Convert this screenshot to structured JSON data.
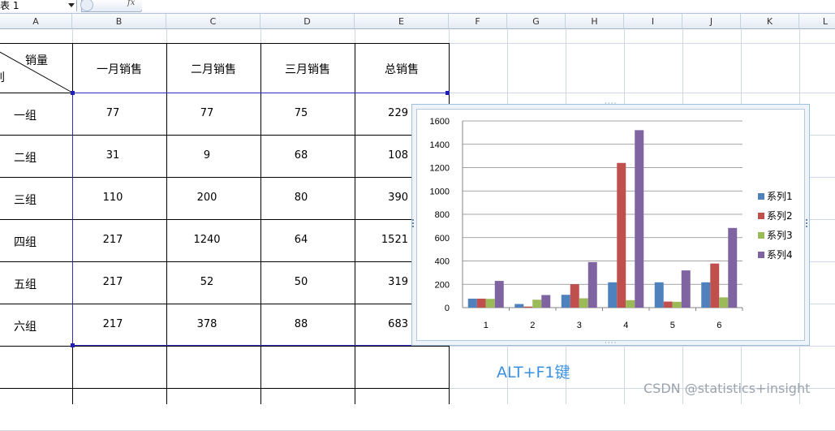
{
  "name_box": {
    "value": "表 1"
  },
  "formula_bar": {
    "fx_label": "fx"
  },
  "columns": [
    "A",
    "B",
    "C",
    "D",
    "E",
    "F",
    "G",
    "H",
    "I",
    "J",
    "K",
    "L"
  ],
  "table": {
    "header_corner_top": "销量",
    "header_corner_bottom": "组别",
    "headers": [
      "一月销售",
      "二月销售",
      "三月销售",
      "总销售"
    ],
    "rows": [
      {
        "group": "一组",
        "jan": "77",
        "feb": "77",
        "mar": "75",
        "total": "229"
      },
      {
        "group": "二组",
        "jan": "31",
        "feb": "9",
        "mar": "68",
        "total": "108"
      },
      {
        "group": "三组",
        "jan": "110",
        "feb": "200",
        "mar": "80",
        "total": "390"
      },
      {
        "group": "四组",
        "jan": "217",
        "feb": "1240",
        "mar": "64",
        "total": "1521"
      },
      {
        "group": "五组",
        "jan": "217",
        "feb": "52",
        "mar": "50",
        "total": "319"
      },
      {
        "group": "六组",
        "jan": "217",
        "feb": "378",
        "mar": "88",
        "total": "683"
      }
    ]
  },
  "chart_data": {
    "type": "bar",
    "categories": [
      "1",
      "2",
      "3",
      "4",
      "5",
      "6"
    ],
    "series": [
      {
        "name": "系列1",
        "color": "#4f81bd",
        "values": [
          77,
          31,
          110,
          217,
          217,
          217
        ]
      },
      {
        "name": "系列2",
        "color": "#c0504d",
        "values": [
          77,
          9,
          200,
          1240,
          52,
          378
        ]
      },
      {
        "name": "系列3",
        "color": "#9bbb59",
        "values": [
          75,
          68,
          80,
          64,
          50,
          88
        ]
      },
      {
        "name": "系列4",
        "color": "#8064a2",
        "values": [
          229,
          108,
          390,
          1521,
          319,
          683
        ]
      }
    ],
    "ylim": [
      0,
      1600
    ],
    "yticks": [
      "0",
      "200",
      "400",
      "600",
      "800",
      "1000",
      "1200",
      "1400",
      "1600"
    ],
    "grid": true,
    "legend": "right"
  },
  "annotation": "ALT+F1键",
  "watermark": "CSDN @statistics+insight"
}
